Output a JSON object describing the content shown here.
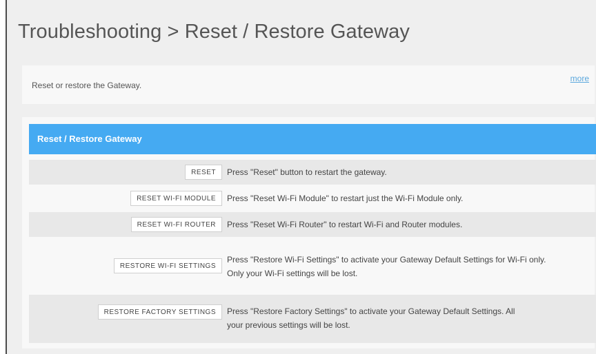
{
  "page": {
    "title": "Troubleshooting > Reset / Restore Gateway",
    "description": "Reset or restore the Gateway.",
    "more_link": "more"
  },
  "panel": {
    "header": "Reset / Restore Gateway",
    "rows": [
      {
        "button": "RESET",
        "text": "Press \"Reset\" button to restart the gateway."
      },
      {
        "button": "RESET WI-FI MODULE",
        "text": "Press \"Reset Wi-Fi Module\" to restart just the Wi-Fi Module only."
      },
      {
        "button": "RESET WI-FI ROUTER",
        "text": "Press \"Reset Wi-Fi Router\" to restart Wi-Fi and Router modules."
      },
      {
        "button": "RESTORE WI-FI SETTINGS",
        "text": "Press \"Restore Wi-Fi Settings\" to activate your Gateway Default Settings for Wi-Fi only. Only your Wi-Fi settings will be lost."
      },
      {
        "button": "RESTORE FACTORY SETTINGS",
        "text": "Press \"Restore Factory Settings\" to activate your Gateway Default Settings. All your previous settings will be lost."
      }
    ]
  }
}
